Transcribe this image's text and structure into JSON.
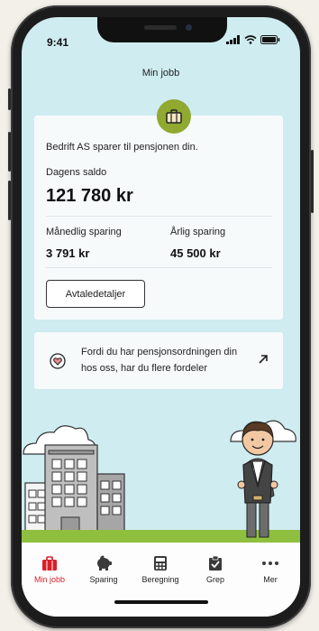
{
  "status_bar": {
    "time": "9:41"
  },
  "header": {
    "title": "Min jobb"
  },
  "savings_card": {
    "intro": "Bedrift AS sparer til pensjonen din.",
    "balance_label": "Dagens saldo",
    "balance_value": "121 780 kr",
    "monthly_label": "Månedlig sparing",
    "monthly_value": "3 791 kr",
    "yearly_label": "Årlig sparing",
    "yearly_value": "45 500 kr",
    "details_button": "Avtaledetaljer"
  },
  "benefit_card": {
    "text": "Fordi du har pensjonsordningen din hos oss, har du flere fordeler"
  },
  "tabs": [
    {
      "label": "Min jobb",
      "icon": "briefcase-icon"
    },
    {
      "label": "Sparing",
      "icon": "piggy-bank-icon"
    },
    {
      "label": "Beregning",
      "icon": "calculator-icon"
    },
    {
      "label": "Grep",
      "icon": "clipboard-check-icon"
    },
    {
      "label": "Mer",
      "icon": "more-dots-icon"
    }
  ],
  "colors": {
    "accent": "#d6202a",
    "brand_green": "#8fa931",
    "background": "#cfecf0",
    "grass": "#8fbf3f"
  }
}
